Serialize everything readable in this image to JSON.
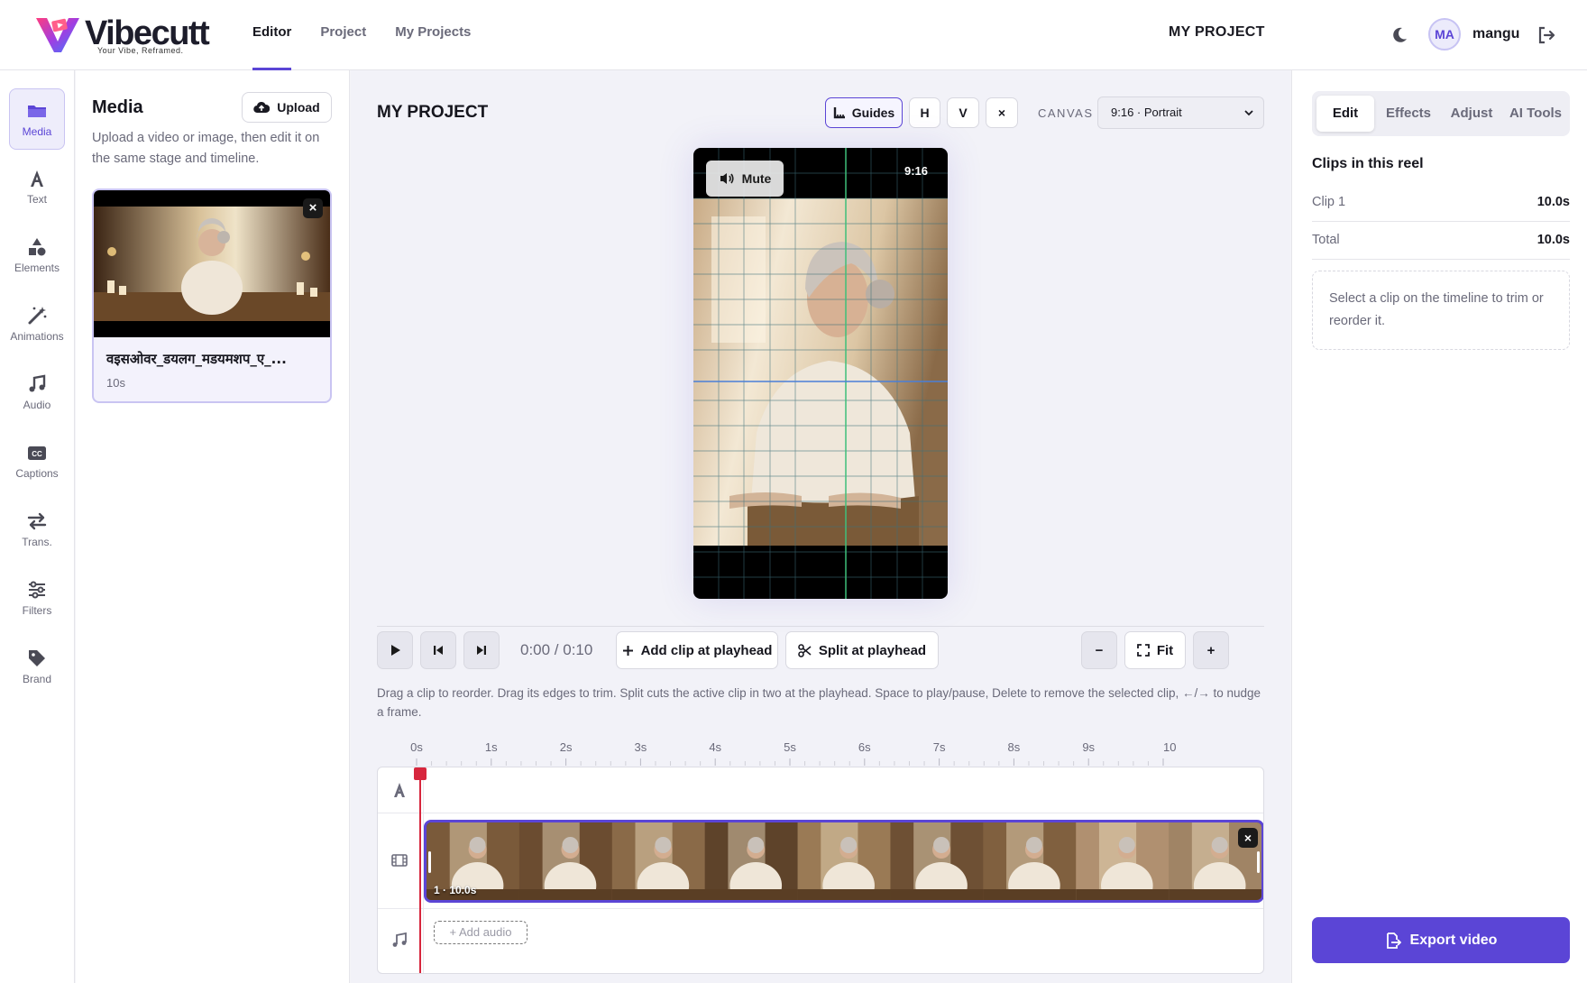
{
  "app": {
    "name": "Vibecutt",
    "tagline": "Your Vibe, Reframed.",
    "accent": "#5b45d6"
  },
  "nav": [
    {
      "label": "Editor",
      "active": true
    },
    {
      "label": "Project",
      "active": false
    },
    {
      "label": "My Projects",
      "active": false
    }
  ],
  "header": {
    "project_name": "MY PROJECT",
    "theme_icon": "moon-icon",
    "avatar_initials": "MA",
    "username": "mangu",
    "logout_icon": "logout-icon"
  },
  "rail": [
    {
      "label": "Media",
      "icon": "folder-icon",
      "active": true
    },
    {
      "label": "Text",
      "icon": "text-icon",
      "active": false
    },
    {
      "label": "Elements",
      "icon": "shapes-icon",
      "active": false
    },
    {
      "label": "Animations",
      "icon": "magic-wand-icon",
      "active": false
    },
    {
      "label": "Audio",
      "icon": "music-note-icon",
      "active": false
    },
    {
      "label": "Captions",
      "icon": "closed-captions-icon",
      "active": false
    },
    {
      "label": "Trans.",
      "icon": "transitions-icon",
      "active": false
    },
    {
      "label": "Filters",
      "icon": "sliders-icon",
      "active": false
    },
    {
      "label": "Brand",
      "icon": "tag-icon",
      "active": false
    }
  ],
  "media": {
    "title": "Media",
    "upload_label": "Upload",
    "description": "Upload a video or image, then edit it on the same stage and timeline.",
    "items": [
      {
        "name": "वइसओवर_डयलग_मडयमशप_ए_...",
        "duration": "10s",
        "close": "×"
      }
    ]
  },
  "stage": {
    "title": "MY PROJECT",
    "guides_label": "Guides",
    "h_label": "H",
    "v_label": "V",
    "clear_label": "×",
    "canvas_label": "CANVAS",
    "canvas_value": "9:16 · Portrait",
    "preview": {
      "mute_label": "Mute",
      "ratio": "9:16"
    }
  },
  "controls": {
    "timecode": "0:00 / 0:10",
    "add_clip_label": "Add clip at playhead",
    "split_label": "Split at playhead",
    "zoom_out": "−",
    "fit_label": "Fit",
    "zoom_in": "+",
    "hint": "Drag a clip to reorder. Drag its edges to trim. Split cuts the active clip in two at the playhead. Space to play/pause, Delete to remove the selected clip, ←/→ to nudge a frame."
  },
  "timeline": {
    "ticks": [
      "0s",
      "1s",
      "2s",
      "3s",
      "4s",
      "5s",
      "6s",
      "7s",
      "8s",
      "9s",
      "10"
    ],
    "playhead_seconds": 0,
    "clip": {
      "label": "1 · 10.0s",
      "close": "×"
    },
    "add_audio_label": "+ Add audio"
  },
  "right": {
    "tabs": [
      {
        "label": "Edit",
        "active": true
      },
      {
        "label": "Effects",
        "active": false
      },
      {
        "label": "Adjust",
        "active": false
      },
      {
        "label": "AI Tools",
        "active": false
      }
    ],
    "clips_title": "Clips in this reel",
    "rows": [
      {
        "key": "Clip 1",
        "value": "10.0s"
      },
      {
        "key": "Total",
        "value": "10.0s"
      }
    ],
    "hint": "Select a clip on the timeline to trim or reorder it.",
    "export_label": "Export video"
  }
}
